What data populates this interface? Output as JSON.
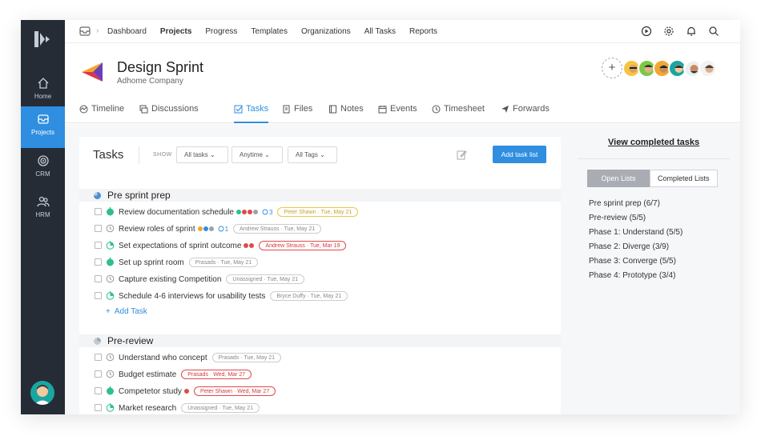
{
  "sidebar": {
    "items": [
      {
        "label": "Home",
        "icon": "home-icon"
      },
      {
        "label": "Projects",
        "icon": "inbox-icon",
        "active": true
      },
      {
        "label": "CRM",
        "icon": "target-icon"
      },
      {
        "label": "HRM",
        "icon": "users-icon"
      }
    ]
  },
  "topnav": {
    "links": [
      {
        "label": "Dashboard"
      },
      {
        "label": "Projects",
        "active": true
      },
      {
        "label": "Progress"
      },
      {
        "label": "Templates"
      },
      {
        "label": "Organizations"
      },
      {
        "label": "All Tasks"
      },
      {
        "label": "Reports"
      }
    ]
  },
  "project": {
    "title": "Design Sprint",
    "company": "Adhome Company",
    "add_member": "+"
  },
  "tabs": [
    {
      "label": "Timeline",
      "icon": "timeline-icon"
    },
    {
      "label": "Discussions",
      "icon": "discussions-icon"
    },
    {
      "label": "Tasks",
      "icon": "tasks-icon",
      "active": true
    },
    {
      "label": "Files",
      "icon": "files-icon"
    },
    {
      "label": "Notes",
      "icon": "notes-icon"
    },
    {
      "label": "Events",
      "icon": "calendar-icon"
    },
    {
      "label": "Timesheet",
      "icon": "clock-icon"
    },
    {
      "label": "Forwards",
      "icon": "send-icon"
    }
  ],
  "tasks_panel": {
    "title": "Tasks",
    "show_label": "SHOW",
    "filters": [
      "All tasks",
      "Anytime",
      "All Tags"
    ],
    "add_task_list": "Add task list",
    "add_task": "Add Task",
    "groups": [
      {
        "name": "Pre sprint prep",
        "tasks": [
          {
            "text": "Review documentation schedule",
            "status": "done",
            "dots": [
              "#2fbf8f",
              "#e04a4a",
              "#e04a4a",
              "#9aa3ad"
            ],
            "comments": "3",
            "assignee": "Peter Shawn",
            "date": "Tue, May 21",
            "tag": "yellow"
          },
          {
            "text": "Review roles of sprint",
            "status": "clock",
            "dots": [
              "#f0a830",
              "#2f8ee0",
              "#9aa3ad"
            ],
            "comments": "1",
            "assignee": "Andrew Strauss",
            "date": "Tue, May 21",
            "tag": "gray"
          },
          {
            "text": "Set expectations of sprint outcome",
            "status": "progress",
            "dots": [
              "#e04a4a",
              "#e04a4a"
            ],
            "comments": "",
            "assignee": "Andrew Strauss",
            "date": "Tue, Mar 19",
            "tag": "red"
          },
          {
            "text": "Set up sprint room",
            "status": "done",
            "dots": [],
            "comments": "",
            "assignee": "Prasads",
            "date": "Tue, May 21",
            "tag": "gray"
          },
          {
            "text": "Capture existing Competition",
            "status": "clock",
            "dots": [],
            "comments": "",
            "assignee": "Unassigned",
            "date": "Tue, May 21",
            "tag": "gray"
          },
          {
            "text": "Schedule 4-6 interviews for usability tests",
            "status": "progress",
            "dots": [],
            "comments": "",
            "assignee": "Bryce Duffy",
            "date": "Tue, May 21",
            "tag": "gray"
          }
        ]
      },
      {
        "name": "Pre-review",
        "tasks": [
          {
            "text": "Understand who concept",
            "status": "clock",
            "dots": [],
            "comments": "",
            "assignee": "Prasads",
            "date": "Tue, May 21",
            "tag": "gray"
          },
          {
            "text": "Budget estimate",
            "status": "clock",
            "dots": [],
            "comments": "",
            "assignee": "Prasads",
            "date": "Wed, Mar 27",
            "tag": "red"
          },
          {
            "text": "Competetor study",
            "status": "done",
            "dots": [
              "#e04a4a"
            ],
            "comments": "",
            "assignee": "Peter Shawn",
            "date": "Wed, Mar 27",
            "tag": "red"
          },
          {
            "text": "Market research",
            "status": "progress",
            "dots": [],
            "comments": "",
            "assignee": "Unassigned",
            "date": "Tue, May 21",
            "tag": "gray"
          }
        ]
      }
    ]
  },
  "right": {
    "view_completed": "View completed tasks",
    "seg_open": "Open Lists",
    "seg_completed": "Completed Lists",
    "lists": [
      "Pre sprint prep (6/7)",
      "Pre-review (5/5)",
      "Phase 1: Understand (5/5)",
      "Phase 2: Diverge (3/9)",
      "Phase 3: Converge (5/5)",
      "Phase 4: Prototype (3/4)"
    ]
  }
}
